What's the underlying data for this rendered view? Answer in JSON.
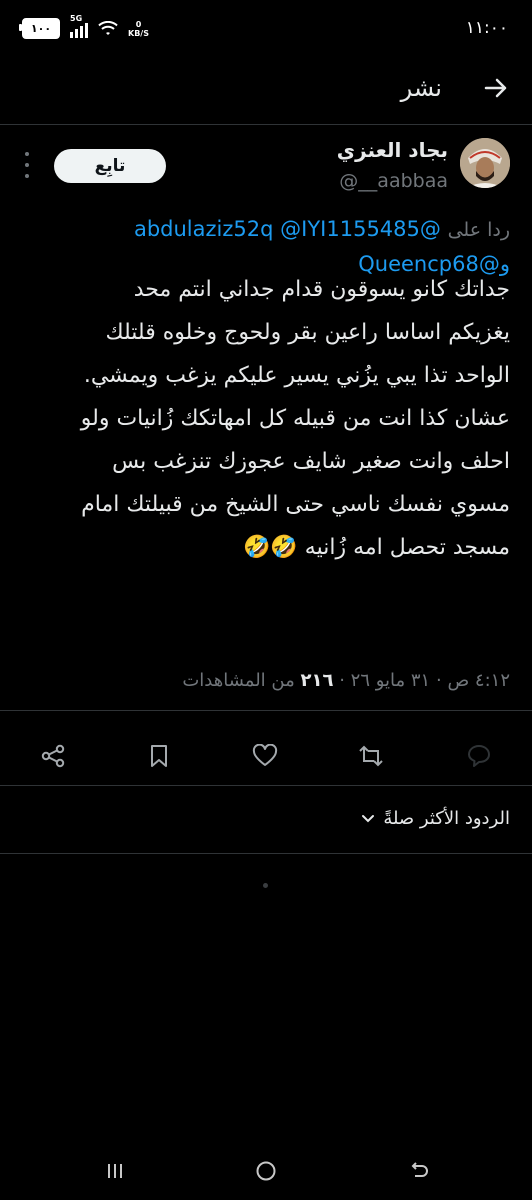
{
  "status_bar": {
    "battery": "١٠٠",
    "network": "5G",
    "speed_value": "0",
    "speed_unit": "KB/S",
    "time": "١١:٠٠"
  },
  "header": {
    "title": "نشر"
  },
  "author": {
    "name": "بجاد العنزي",
    "handle": "@__aabbaa",
    "follow_label": "تابِع"
  },
  "reply_to": {
    "label": "ردا على",
    "mention1": "@IYI1155485",
    "mention2": "@abdulaziz52q",
    "and": "و",
    "mention3": "@Queencp68"
  },
  "tweet": {
    "lines": [
      "جداتك كانو يسوقون قدام جداني  انتم محد",
      "يغزيكم اساسا راعين بقر ولحوج وخلوه  قلتلك",
      "الواحد تذا يبي يزُني يسير عليكم يزغب ويمشي.",
      "عشان كذا انت من قبيله كل امهاتكك زُانيات ولو",
      "احلف وانت صغير شايف عجوزك تنزغب بس",
      "مسوي نفسك ناسي حتى الشيخ من قبيلتك امام",
      "مسجد تحصل امه زُانيه 🤣🤣"
    ]
  },
  "meta": {
    "time": "٤:١٢ ص",
    "date": "٣١ مايو ٢٦",
    "views_count": "٢١٦",
    "views_label": "من المشاهدات",
    "sep": "·"
  },
  "replies": {
    "sort_label": "الردود الأكثر صلةً"
  }
}
